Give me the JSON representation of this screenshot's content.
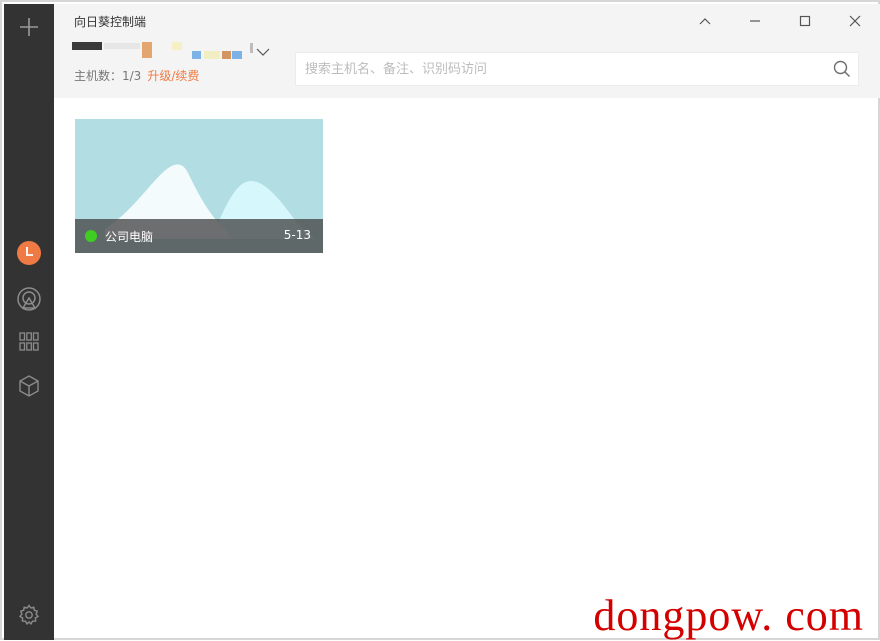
{
  "app": {
    "title": "向日葵控制端"
  },
  "window_controls": {
    "collapse_icon": "chevron-up-icon",
    "minimize_icon": "minimize-icon",
    "maximize_icon": "maximize-icon",
    "close_icon": "close-icon"
  },
  "sidebar": {
    "items": [
      {
        "id": "add",
        "icon": "plus-icon"
      },
      {
        "id": "recent",
        "icon": "clock-icon",
        "active": true
      },
      {
        "id": "remote",
        "icon": "remote-signal-icon"
      },
      {
        "id": "apps",
        "icon": "grid-icon"
      },
      {
        "id": "box",
        "icon": "cube-icon"
      },
      {
        "id": "settings",
        "icon": "gear-icon"
      }
    ],
    "active_color": "#ef7a43"
  },
  "account": {
    "host_count_label": "主机数：1/3",
    "upgrade_label": "升级/续费"
  },
  "search": {
    "placeholder": "搜索主机名、备注、识别码访问"
  },
  "hosts": [
    {
      "name": "公司电脑",
      "date": "5-13",
      "status": "online"
    }
  ],
  "colors": {
    "accent": "#ef7a43",
    "online": "#3fcd22",
    "sidebar": "#333333",
    "header": "#f4f4f4"
  },
  "watermark": "dongpow. com"
}
